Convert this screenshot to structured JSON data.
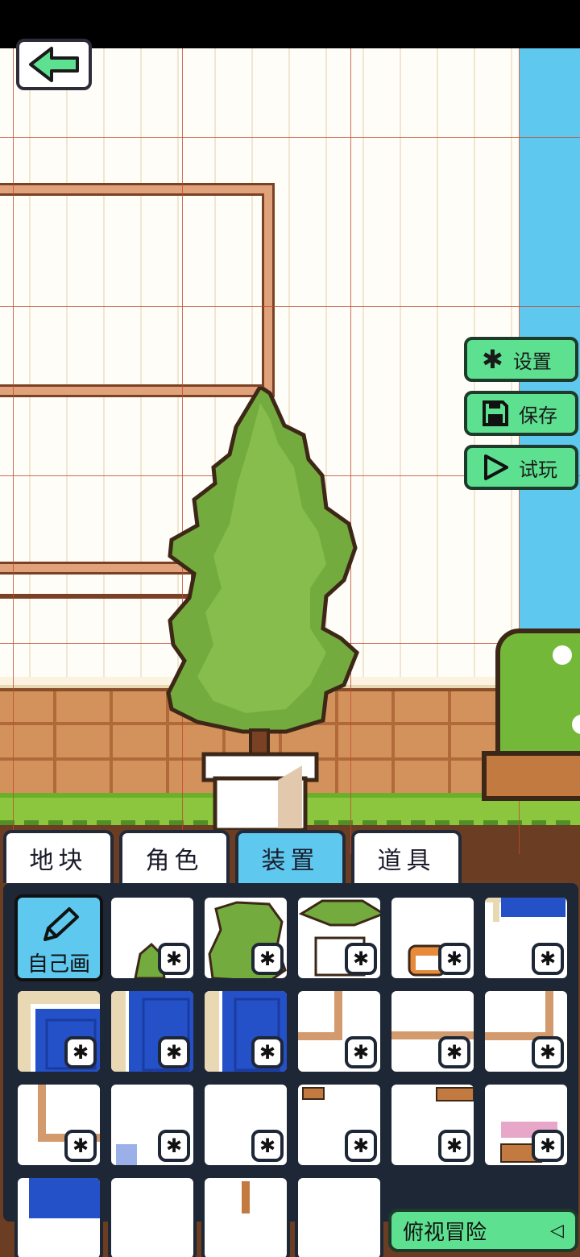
{
  "header": {
    "back_icon": "arrow-left-icon"
  },
  "side_menu": [
    {
      "label": "设置",
      "icon": "gear-icon"
    },
    {
      "label": "保存",
      "icon": "floppy-disk-icon"
    },
    {
      "label": "试玩",
      "icon": "play-icon"
    }
  ],
  "tabs": [
    {
      "label": "地块",
      "active": false
    },
    {
      "label": "角色",
      "active": false
    },
    {
      "label": "装置",
      "active": true
    },
    {
      "label": "道具",
      "active": false
    }
  ],
  "palette": {
    "draw_label": "自己画",
    "draw_icon": "pencil-icon",
    "items": [
      "small-bush",
      "large-bush",
      "potted-tree",
      "shiba-dog",
      "window-corner",
      "window-left",
      "window-center",
      "window-right",
      "frame-corner-tr",
      "frame-top",
      "frame-top-right",
      "frame-corner-bl",
      "flower-sprig",
      "empty",
      "shelf-small",
      "shelf-wide",
      "flower-planter"
    ]
  },
  "mode_button": {
    "label": "俯视冒险",
    "icon": "triangle-left-icon"
  },
  "colors": {
    "accent_green": "#5de08f",
    "accent_blue": "#5ec8ee",
    "frame_dark": "#1e2736"
  }
}
